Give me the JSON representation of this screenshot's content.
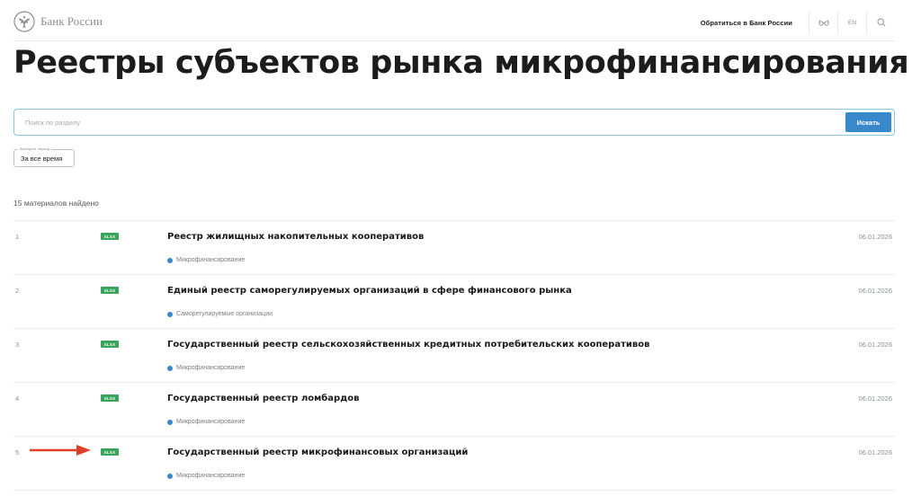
{
  "header": {
    "logo_text": "Банк России",
    "contact_label": "Обратиться в Банк России",
    "lang_label": "EN",
    "icons": [
      "bank-emblem-icon",
      "accessibility-glasses-icon",
      "search-icon"
    ]
  },
  "page": {
    "title": "Реестры субъектов рынка микрофинансирования"
  },
  "search": {
    "placeholder": "Поиск по разделу",
    "value": "",
    "button_label": "Искать"
  },
  "period": {
    "legend": "Выберите период",
    "value": "За все время"
  },
  "results": {
    "count_text": "15 материалов найдено"
  },
  "items": [
    {
      "num": "1",
      "badge": "XLSX",
      "title": "Реестр жилищных накопительных кооперативов",
      "tag": "Микрофинансирование",
      "date": "06.01.2026"
    },
    {
      "num": "2",
      "badge": "XLSX",
      "title": "Единый реестр саморегулируемых организаций в сфере финансового рынка",
      "tag": "Саморегулируемые организации",
      "date": "06.01.2026"
    },
    {
      "num": "3",
      "badge": "XLSX",
      "title": "Государственный реестр сельскохозяйственных кредитных потребительских кооперативов",
      "tag": "Микрофинансирование",
      "date": "06.01.2026"
    },
    {
      "num": "4",
      "badge": "XLSX",
      "title": "Государственный реестр ломбардов",
      "tag": "Микрофинансирование",
      "date": "06.01.2026"
    },
    {
      "num": "5",
      "badge": "XLSX",
      "title": "Государственный реестр микрофинансовых организаций",
      "tag": "Микрофинансирование",
      "date": "06.01.2026"
    }
  ],
  "colors": {
    "accent": "#3a88cc",
    "badge_green": "#3aa35c",
    "annotation_arrow": "#e0402a",
    "search_border": "#84c6e6"
  }
}
